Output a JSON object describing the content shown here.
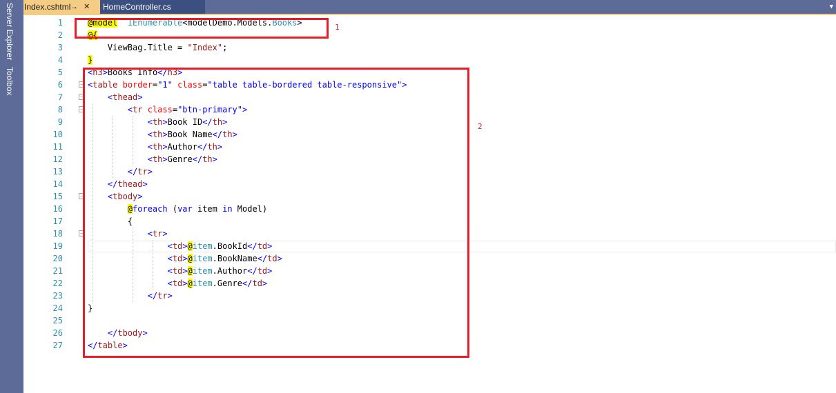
{
  "side_tabs": [
    "Server Explorer",
    "Toolbox"
  ],
  "tabs": {
    "active": "Index.cshtml",
    "pin": "→",
    "close": "✕",
    "inactive": "HomeController.cs"
  },
  "dropdown_icon": "chevron-down-icon",
  "annotations": [
    "1",
    "2"
  ],
  "lines": [
    {
      "n": "1",
      "t": [
        [
          "razor",
          "@model"
        ],
        [
          "txt",
          "  "
        ],
        [
          "type",
          "IEnumerable"
        ],
        [
          "txt",
          "<modelDemo.Models."
        ],
        [
          "type",
          "Books"
        ],
        [
          "txt",
          ">"
        ]
      ]
    },
    {
      "n": "2",
      "t": [
        [
          "razor",
          "@{"
        ]
      ]
    },
    {
      "n": "3",
      "t": [
        [
          "txt",
          "    ViewBag.Title = "
        ],
        [
          "str",
          "\"Index\""
        ],
        [
          "txt",
          ";"
        ]
      ]
    },
    {
      "n": "4",
      "t": [
        [
          "razor",
          "}"
        ]
      ]
    },
    {
      "n": "5",
      "t": [
        [
          "val",
          "<"
        ],
        [
          "tag",
          "h3"
        ],
        [
          "val",
          ">"
        ],
        [
          "txt",
          "Books Info"
        ],
        [
          "val",
          "</"
        ],
        [
          "tag",
          "h3"
        ],
        [
          "val",
          ">"
        ]
      ]
    },
    {
      "n": "6",
      "t": [
        [
          "val",
          "<"
        ],
        [
          "tag",
          "table"
        ],
        [
          "txt",
          " "
        ],
        [
          "attr",
          "border"
        ],
        [
          "txt",
          "="
        ],
        [
          "val",
          "\"1\""
        ],
        [
          "txt",
          " "
        ],
        [
          "attr",
          "class"
        ],
        [
          "txt",
          "="
        ],
        [
          "val",
          "\"table table-bordered table-responsive\""
        ],
        [
          "val",
          ">"
        ]
      ]
    },
    {
      "n": "7",
      "t": [
        [
          "txt",
          "    "
        ],
        [
          "val",
          "<"
        ],
        [
          "tag",
          "thead"
        ],
        [
          "val",
          ">"
        ]
      ]
    },
    {
      "n": "8",
      "t": [
        [
          "txt",
          "        "
        ],
        [
          "val",
          "<"
        ],
        [
          "tag",
          "tr"
        ],
        [
          "txt",
          " "
        ],
        [
          "attr",
          "class"
        ],
        [
          "txt",
          "="
        ],
        [
          "val",
          "\"btn-primary\""
        ],
        [
          "val",
          ">"
        ]
      ]
    },
    {
      "n": "9",
      "t": [
        [
          "txt",
          "            "
        ],
        [
          "val",
          "<"
        ],
        [
          "tag",
          "th"
        ],
        [
          "val",
          ">"
        ],
        [
          "txt",
          "Book ID"
        ],
        [
          "val",
          "</"
        ],
        [
          "tag",
          "th"
        ],
        [
          "val",
          ">"
        ]
      ]
    },
    {
      "n": "10",
      "t": [
        [
          "txt",
          "            "
        ],
        [
          "val",
          "<"
        ],
        [
          "tag",
          "th"
        ],
        [
          "val",
          ">"
        ],
        [
          "txt",
          "Book Name"
        ],
        [
          "val",
          "</"
        ],
        [
          "tag",
          "th"
        ],
        [
          "val",
          ">"
        ]
      ]
    },
    {
      "n": "11",
      "t": [
        [
          "txt",
          "            "
        ],
        [
          "val",
          "<"
        ],
        [
          "tag",
          "th"
        ],
        [
          "val",
          ">"
        ],
        [
          "txt",
          "Author"
        ],
        [
          "val",
          "</"
        ],
        [
          "tag",
          "th"
        ],
        [
          "val",
          ">"
        ]
      ]
    },
    {
      "n": "12",
      "t": [
        [
          "txt",
          "            "
        ],
        [
          "val",
          "<"
        ],
        [
          "tag",
          "th"
        ],
        [
          "val",
          ">"
        ],
        [
          "txt",
          "Genre"
        ],
        [
          "val",
          "</"
        ],
        [
          "tag",
          "th"
        ],
        [
          "val",
          ">"
        ]
      ]
    },
    {
      "n": "13",
      "t": [
        [
          "txt",
          "        "
        ],
        [
          "val",
          "</"
        ],
        [
          "tag",
          "tr"
        ],
        [
          "val",
          ">"
        ]
      ]
    },
    {
      "n": "14",
      "t": [
        [
          "txt",
          "    "
        ],
        [
          "val",
          "</"
        ],
        [
          "tag",
          "thead"
        ],
        [
          "val",
          ">"
        ]
      ]
    },
    {
      "n": "15",
      "t": [
        [
          "txt",
          "    "
        ],
        [
          "val",
          "<"
        ],
        [
          "tag",
          "tbody"
        ],
        [
          "val",
          ">"
        ]
      ]
    },
    {
      "n": "16",
      "t": [
        [
          "txt",
          "        "
        ],
        [
          "razor",
          "@"
        ],
        [
          "kw",
          "foreach"
        ],
        [
          "txt",
          " ("
        ],
        [
          "kw",
          "var"
        ],
        [
          "txt",
          " item "
        ],
        [
          "kw",
          "in"
        ],
        [
          "txt",
          " Model)"
        ]
      ]
    },
    {
      "n": "17",
      "t": [
        [
          "txt",
          "        {"
        ]
      ]
    },
    {
      "n": "18",
      "t": [
        [
          "txt",
          "            "
        ],
        [
          "val",
          "<"
        ],
        [
          "tag",
          "tr"
        ],
        [
          "val",
          ">"
        ]
      ]
    },
    {
      "n": "19",
      "t": [
        [
          "txt",
          "                "
        ],
        [
          "val",
          "<"
        ],
        [
          "tag",
          "td"
        ],
        [
          "val",
          ">"
        ],
        [
          "razor",
          "@"
        ],
        [
          "type",
          "item"
        ],
        [
          "txt",
          ".BookId"
        ],
        [
          "val",
          "</"
        ],
        [
          "tag",
          "td"
        ],
        [
          "val",
          ">"
        ]
      ]
    },
    {
      "n": "20",
      "t": [
        [
          "txt",
          "                "
        ],
        [
          "val",
          "<"
        ],
        [
          "tag",
          "td"
        ],
        [
          "val",
          ">"
        ],
        [
          "razor",
          "@"
        ],
        [
          "type",
          "item"
        ],
        [
          "txt",
          ".BookName"
        ],
        [
          "val",
          "</"
        ],
        [
          "tag",
          "td"
        ],
        [
          "val",
          ">"
        ]
      ]
    },
    {
      "n": "21",
      "t": [
        [
          "txt",
          "                "
        ],
        [
          "val",
          "<"
        ],
        [
          "tag",
          "td"
        ],
        [
          "val",
          ">"
        ],
        [
          "razor",
          "@"
        ],
        [
          "type",
          "item"
        ],
        [
          "txt",
          ".Author"
        ],
        [
          "val",
          "</"
        ],
        [
          "tag",
          "td"
        ],
        [
          "val",
          ">"
        ]
      ]
    },
    {
      "n": "22",
      "t": [
        [
          "txt",
          "                "
        ],
        [
          "val",
          "<"
        ],
        [
          "tag",
          "td"
        ],
        [
          "val",
          ">"
        ],
        [
          "razor",
          "@"
        ],
        [
          "type",
          "item"
        ],
        [
          "txt",
          ".Genre"
        ],
        [
          "val",
          "</"
        ],
        [
          "tag",
          "td"
        ],
        [
          "val",
          ">"
        ]
      ]
    },
    {
      "n": "23",
      "t": [
        [
          "txt",
          "            "
        ],
        [
          "val",
          "</"
        ],
        [
          "tag",
          "tr"
        ],
        [
          "val",
          ">"
        ]
      ]
    },
    {
      "n": "24",
      "t": [
        [
          "txt",
          "}"
        ]
      ]
    },
    {
      "n": "25",
      "t": []
    },
    {
      "n": "26",
      "t": [
        [
          "txt",
          "    "
        ],
        [
          "val",
          "</"
        ],
        [
          "tag",
          "tbody"
        ],
        [
          "val",
          ">"
        ]
      ]
    },
    {
      "n": "27",
      "t": [
        [
          "val",
          "</"
        ],
        [
          "tag",
          "table"
        ],
        [
          "val",
          ">"
        ]
      ]
    }
  ],
  "fold_lines": [
    "6",
    "7",
    "8",
    "15",
    "18"
  ]
}
